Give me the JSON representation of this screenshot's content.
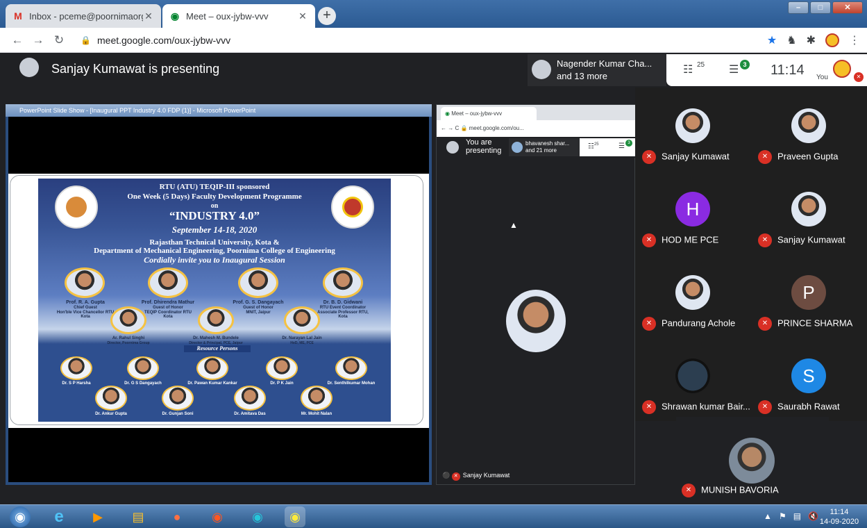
{
  "browser": {
    "tabs": [
      {
        "title": "Inbox - pceme@poornimaorg - I",
        "icon": "gmail-icon"
      },
      {
        "title": "Meet – oux-jybw-vvv",
        "icon": "meet-icon"
      }
    ],
    "url": "meet.google.com/oux-jybw-vvv"
  },
  "meet": {
    "presenting_text": "Sanjay Kumawat is presenting",
    "participants_chip": {
      "line1": "Nagender Kumar Cha...",
      "line2": "and 13 more"
    },
    "people_count": "25",
    "chat_badge": "3",
    "time": "11:14",
    "you_label": "You"
  },
  "ppt": {
    "window_title": "PowerPoint Slide Show - [Inaugural PPT Industry 4.0 FDP (1)] - Microsoft PowerPoint"
  },
  "slide": {
    "line1": "RTU (ATU) TEQIP-III sponsored",
    "line2": "One Week (5 Days) Faculty Development Programme",
    "line3": "on",
    "line4": "“INDUSTRY 4.0”",
    "line5": "September 14-18, 2020",
    "line6": "Rajasthan Technical University, Kota &",
    "line7": "Department of Mechanical Engineering, Poornima College of Engineering",
    "line8": "Cordially invite you to Inaugural Session",
    "guests": [
      {
        "name": "Prof. R. A. Gupta",
        "role": "Chief Guest",
        "org": "Hon'ble Vice Chancellor RTU Kota"
      },
      {
        "name": "Prof. Dhirendra Mathur",
        "role": "Guest of Honor",
        "org": "TEQIP Coordinator RTU Kota"
      },
      {
        "name": "Prof. G. S. Dangayach",
        "role": "Guest of Honor",
        "org": "MNIT, Jaipur"
      },
      {
        "name": "Dr. B. D. Gidwani",
        "role": "RTU Event Coordinator",
        "org": "Associate Professor RTU, Kota"
      }
    ],
    "hosts": [
      {
        "name": "Ar. Rahul Singhi",
        "org": "Director, Poornima Group"
      },
      {
        "name": "Dr. Mahesh M. Bundele",
        "org": "Director & Principal, PCE, Jaipur"
      },
      {
        "name": "Dr. Narayan Lal Jain",
        "org": "HoD, ME, PCE"
      }
    ],
    "resource_title": "Resource Persons",
    "resource_persons": [
      "Dr. S P Harsha",
      "Dr. G S Dangayach",
      "Dr. Pawan Kumar Kankar",
      "Dr. P K Jain",
      "Dr. Senthilkumar Mohan",
      "Dr. Ankur Gupta",
      "Dr. Gunjan Soni",
      "Dr. Amitava Das",
      "Mr. Mohit Nalan"
    ]
  },
  "nested": {
    "tab_title": "Meet – oux-jybw-vvv",
    "url": "meet.google.com/ou...",
    "you_presenting": "You are presenting",
    "chip_line1": "bhavanesh shar...",
    "chip_line2": "and 21 more",
    "people_count": "25",
    "chat_badge": "3",
    "bottom_name": "Sanjay Kumawat"
  },
  "participants": [
    {
      "name": "Sanjay Kumawat",
      "avatar": "photo",
      "color": ""
    },
    {
      "name": "Praveen Gupta",
      "avatar": "photo",
      "color": ""
    },
    {
      "name": "HOD ME PCE",
      "avatar": "H",
      "color": "#8a2be2"
    },
    {
      "name": "Sanjay Kumawat",
      "avatar": "photo",
      "color": ""
    },
    {
      "name": "Pandurang Achole",
      "avatar": "photo",
      "color": ""
    },
    {
      "name": "PRINCE SHARMA",
      "avatar": "P",
      "color": "#6d4c41"
    },
    {
      "name": "Shrawan kumar Bair...",
      "avatar": "photo",
      "color": ""
    },
    {
      "name": "Saurabh Rawat",
      "avatar": "S",
      "color": "#1e88e5"
    }
  ],
  "last_participant": {
    "name": "MUNISH BAVORIA"
  },
  "taskbar": {
    "time": "11:14",
    "date": "14-09-2020"
  }
}
